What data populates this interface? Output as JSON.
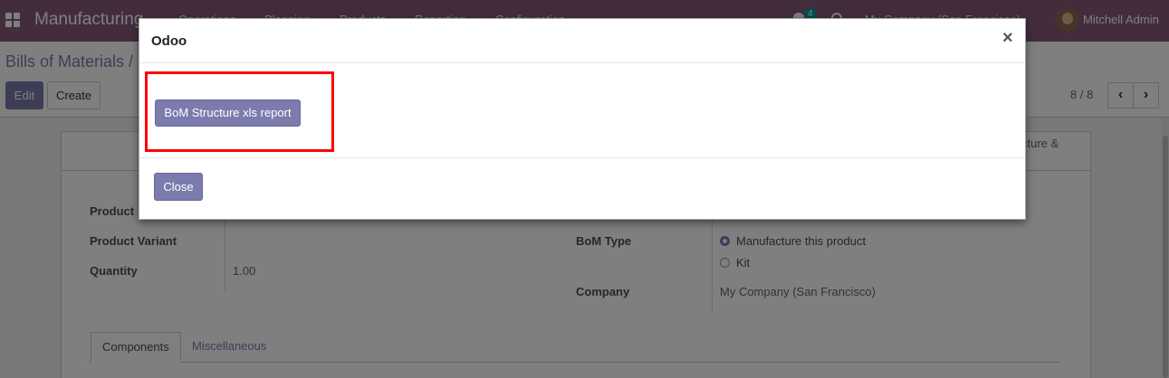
{
  "navbar": {
    "app_name": "Manufacturing",
    "menu": [
      "Operations",
      "Planning",
      "Products",
      "Reporting",
      "Configuration"
    ],
    "chat_count": "4",
    "company": "My Company (San Francisco)",
    "user": "Mitchell Admin",
    "color": "#875a7b"
  },
  "control_panel": {
    "breadcrumb": "Bills of Materials / [",
    "edit_label": "Edit",
    "create_label": "Create",
    "pager": "8 / 8",
    "prev_icon": "‹",
    "next_icon": "›"
  },
  "form": {
    "stat_button_text": "cture &\nt",
    "labels": {
      "product": "Product",
      "product_variant": "Product Variant",
      "quantity": "Quantity",
      "bom_type": "BoM Type",
      "company": "Company"
    },
    "quantity_value": "1.00",
    "bom_type_options": [
      "Manufacture this product",
      "Kit"
    ],
    "company_value": "My Company (San Francisco)",
    "tabs": [
      "Components",
      "Miscellaneous"
    ]
  },
  "modal": {
    "title": "Odoo",
    "close_icon": "×",
    "report_button": "BoM Structure xls report",
    "close_button": "Close",
    "highlight_color": "#ff0000",
    "button_color": "#7c7bad"
  }
}
